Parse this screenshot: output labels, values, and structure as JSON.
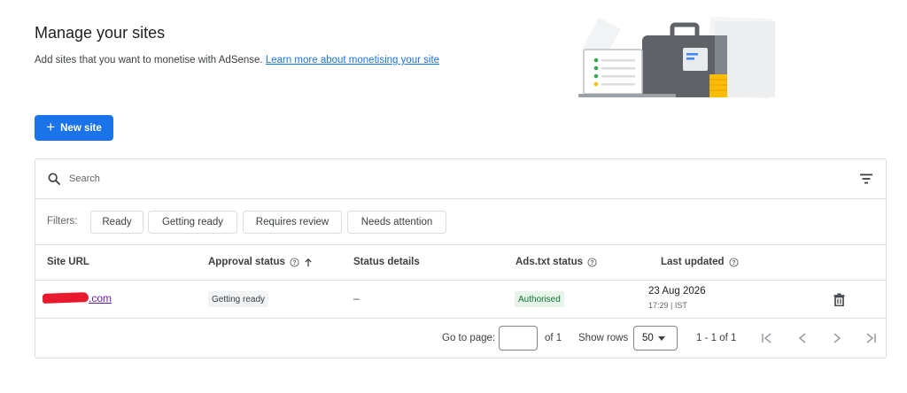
{
  "header": {
    "title": "Manage your sites",
    "subtitle": "Add sites that you want to monetise with AdSense.",
    "learn_more_link": "Learn more about monetising your site"
  },
  "toolbar": {
    "new_site_label": "New site"
  },
  "search": {
    "placeholder": "Search",
    "value": ""
  },
  "filters": {
    "label": "Filters:",
    "chips": [
      "Ready",
      "Getting ready",
      "Requires review",
      "Needs attention"
    ]
  },
  "table": {
    "columns": [
      "Site URL",
      "Approval status",
      "Status details",
      "Ads.txt status",
      "Last updated"
    ],
    "rows": [
      {
        "site_url": ".com",
        "approval_status": "Getting ready",
        "status_details": "–",
        "ads_txt_status": "Authorised",
        "last_updated_date": "23 Aug 2026",
        "last_updated_time": "17:29 | IST"
      }
    ]
  },
  "pagination": {
    "go_to_label": "Go to page:",
    "page_value": "",
    "of_total": "of 1",
    "show_rows_label": "Show rows",
    "rows_per_page": "50",
    "range": "1 - 1 of 1"
  },
  "icons": {
    "search": "search-icon",
    "filter": "filter-list-icon",
    "help": "help-circle-icon",
    "sort": "arrow-up-icon",
    "delete": "trash-icon",
    "first": "first-page-icon",
    "prev": "chevron-left-icon",
    "next": "chevron-right-icon",
    "last": "last-page-icon"
  },
  "colors": {
    "primary": "#1a73e8",
    "visited_link": "#681da8",
    "authorised_bg": "#e6f4ea",
    "authorised_text": "#137333",
    "pending_bg": "#f1f3f4",
    "border": "#dadce0",
    "redaction": "#e8192c"
  }
}
